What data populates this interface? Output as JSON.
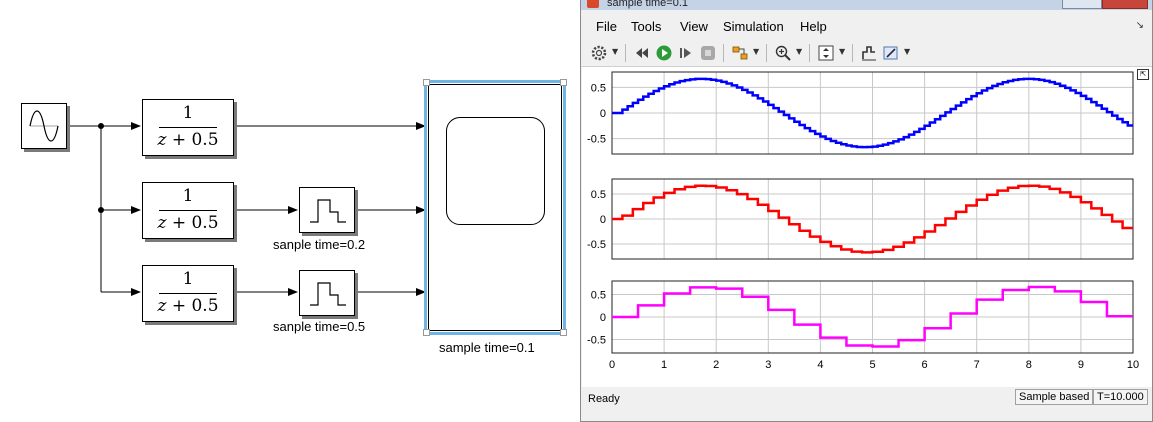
{
  "diagram": {
    "transfer_functions": [
      {
        "numerator": "1",
        "denominator_var": "z",
        "denominator_rest": " + 0.5"
      },
      {
        "numerator": "1",
        "denominator_var": "z",
        "denominator_rest": " + 0.5"
      },
      {
        "numerator": "1",
        "denominator_var": "z",
        "denominator_rest": " + 0.5"
      }
    ],
    "zoh_labels": [
      "sanple time=0.2",
      "sanple time=0.5"
    ],
    "scope_label": "sample time=0.1"
  },
  "window": {
    "title": "sample time=0.1",
    "menu": [
      "File",
      "Tools",
      "View",
      "Simulation",
      "Help"
    ],
    "menu_arrow": "↘"
  },
  "toolbar": {
    "icons": [
      "gear-icon",
      "rewind-icon",
      "run-icon",
      "step-forward-icon",
      "stop-icon",
      "highlight-icon",
      "zoom-icon",
      "scale-axes-icon",
      "style-icon",
      "cursor-icon"
    ]
  },
  "status": {
    "ready": "Ready",
    "mode": "Sample based",
    "time": "T=10.000"
  },
  "chart_data": [
    {
      "type": "line",
      "series": [
        {
          "color": "#0000ff",
          "sampling": 0.1,
          "style": "stair"
        }
      ],
      "x_range": [
        0,
        10
      ],
      "ylim": [
        -0.8,
        0.8
      ],
      "yticks": [
        "0.5",
        "0",
        "-0.5"
      ],
      "grid": true
    },
    {
      "type": "line",
      "series": [
        {
          "color": "#ff0000",
          "sampling": 0.2,
          "style": "stair"
        }
      ],
      "x_range": [
        0,
        10
      ],
      "ylim": [
        -0.8,
        0.8
      ],
      "yticks": [
        "0.5",
        "0",
        "-0.5"
      ],
      "grid": true
    },
    {
      "type": "line",
      "series": [
        {
          "color": "#ff00ff",
          "sampling": 0.5,
          "style": "stair"
        }
      ],
      "x_range": [
        0,
        10
      ],
      "ylim": [
        -0.8,
        0.8
      ],
      "yticks": [
        "0.5",
        "0",
        "-0.5"
      ],
      "xticks": [
        "0",
        "1",
        "2",
        "3",
        "4",
        "5",
        "6",
        "7",
        "8",
        "9",
        "10"
      ],
      "grid": true
    }
  ]
}
